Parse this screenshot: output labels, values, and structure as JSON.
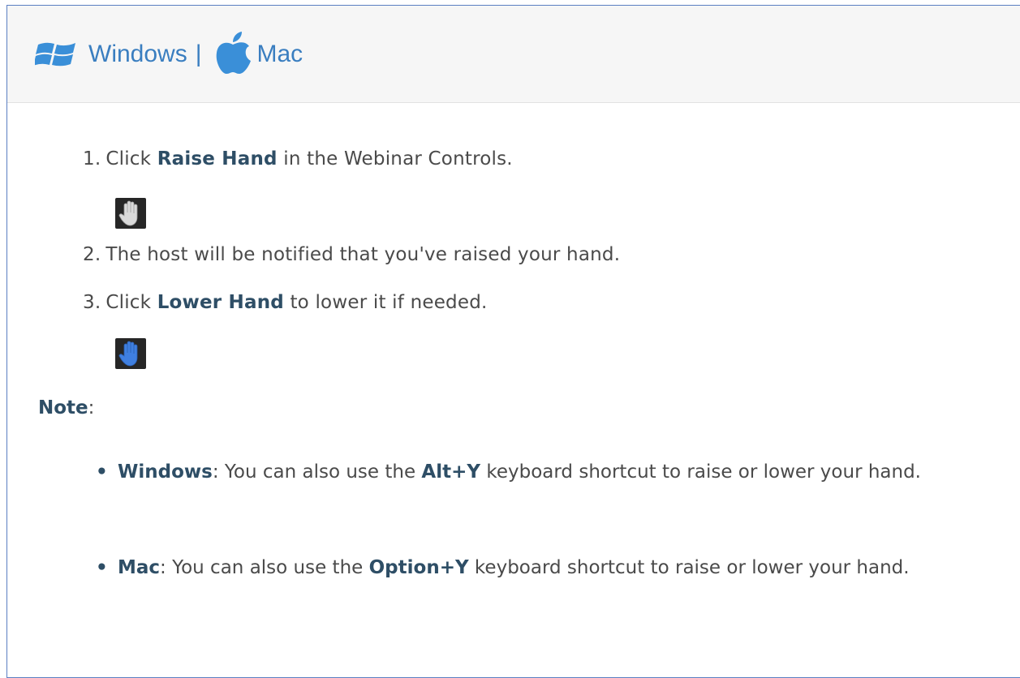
{
  "tabs": {
    "windows_label": "Windows",
    "separator": "|",
    "mac_label": "Mac"
  },
  "steps": [
    {
      "num": "1.",
      "pre": "Click ",
      "bold": "Raise Hand",
      "post": " in the Webinar Controls."
    },
    {
      "num": "2.",
      "text": "The host will be notified that you've raised your hand."
    },
    {
      "num": "3.",
      "pre": "Click ",
      "bold": "Lower Hand",
      "post": " to lower it if needed."
    }
  ],
  "icons": {
    "raise_hand": "raise-hand-icon",
    "lower_hand": "lower-hand-icon",
    "windows": "windows-logo-icon",
    "apple": "apple-logo-icon"
  },
  "note": {
    "label": "Note",
    "colon": ":",
    "bullets": [
      {
        "bold": "Windows",
        "mid": ": You can also use the ",
        "key": "Alt+Y",
        "post": " keyboard shortcut to raise or lower your hand."
      },
      {
        "bold": "Mac",
        "mid": ": You can also use the ",
        "key": "Option+Y",
        "post": " keyboard shortcut to raise or lower your hand."
      }
    ]
  },
  "colors": {
    "link": "#3a7ec0",
    "bold_text": "#2e4e66",
    "body_text": "#4a4a4a",
    "header_bg": "#f6f6f6",
    "frame_border": "#5b7fc2",
    "lower_hand_blue": "#3f7fe0"
  }
}
